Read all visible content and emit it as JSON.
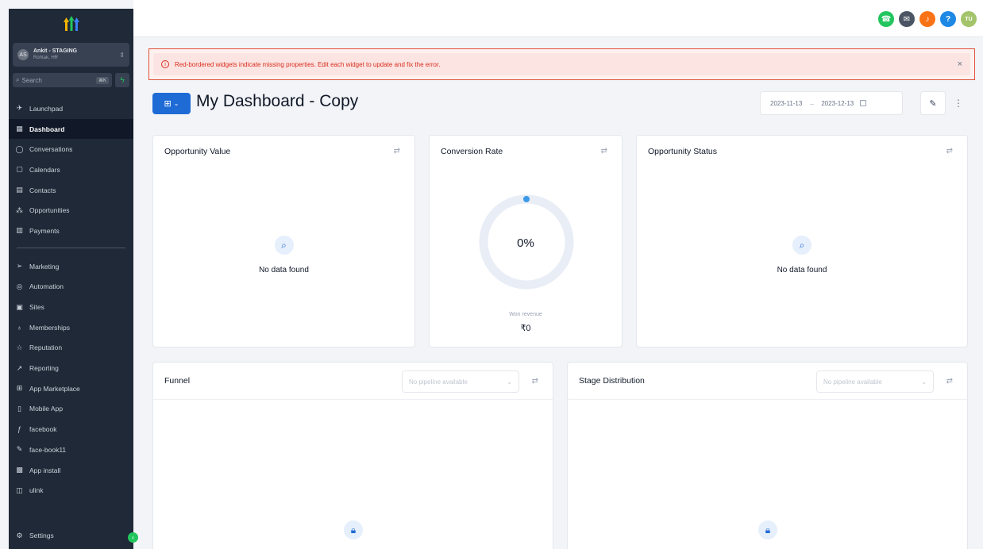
{
  "sidebar": {
    "account": {
      "avatar": "AS",
      "name": "Ankit - STAGING",
      "sub": "Rohtak, HR"
    },
    "search": {
      "placeholder": "Search",
      "shortcut": "⌘K"
    },
    "nav_top": [
      {
        "label": "Launchpad",
        "icon": "rocket-icon"
      },
      {
        "label": "Dashboard",
        "icon": "dashboard-grid-icon",
        "active": true
      },
      {
        "label": "Conversations",
        "icon": "chat-bubble-icon"
      },
      {
        "label": "Calendars",
        "icon": "calendar-icon"
      },
      {
        "label": "Contacts",
        "icon": "contacts-icon"
      },
      {
        "label": "Opportunities",
        "icon": "opportunities-icon"
      },
      {
        "label": "Payments",
        "icon": "payments-icon"
      }
    ],
    "nav_bottom": [
      {
        "label": "Marketing",
        "icon": "send-icon"
      },
      {
        "label": "Automation",
        "icon": "automation-icon"
      },
      {
        "label": "Sites",
        "icon": "sites-icon"
      },
      {
        "label": "Memberships",
        "icon": "membership-icon"
      },
      {
        "label": "Reputation",
        "icon": "star-icon"
      },
      {
        "label": "Reporting",
        "icon": "chart-line-icon"
      },
      {
        "label": "App Marketplace",
        "icon": "apps-grid-icon"
      },
      {
        "label": "Mobile App",
        "icon": "mobile-icon"
      },
      {
        "label": "facebook",
        "icon": "facebook-icon"
      },
      {
        "label": "face-book11",
        "icon": "brush-icon"
      },
      {
        "label": "App install",
        "icon": "app-install-icon"
      },
      {
        "label": "ulink",
        "icon": "link-box-icon"
      }
    ],
    "settings": {
      "label": "Settings",
      "icon": "gear-icon"
    }
  },
  "topbar": {
    "icons": [
      {
        "name": "phone-icon",
        "color": "#22c55e"
      },
      {
        "name": "megaphone-icon",
        "color": "#4b5563"
      },
      {
        "name": "bell-icon",
        "color": "#f97316"
      },
      {
        "name": "help-icon",
        "color": "#1e88e5",
        "glyph": "?"
      },
      {
        "name": "user-avatar",
        "color": "#a3c46a",
        "glyph": "TU"
      }
    ]
  },
  "alert": {
    "text": "Red-bordered widgets indicate missing properties. Edit each widget to update and fix the error.",
    "close": "×"
  },
  "header": {
    "title": "My Dashboard - Copy",
    "date_start": "2023-11-13",
    "date_arrow": "→",
    "date_end": "2023-12-13"
  },
  "widgets": {
    "opportunity_value": {
      "title": "Opportunity Value",
      "empty_text": "No data found"
    },
    "conversion_rate": {
      "title": "Conversion Rate",
      "percent_label": "0%",
      "percent": 0,
      "caption": "Won revenue",
      "amount": "₹0"
    },
    "opportunity_status": {
      "title": "Opportunity Status",
      "empty_text": "No data found"
    },
    "funnel": {
      "title": "Funnel",
      "select_placeholder": "No pipeline available"
    },
    "stage_distribution": {
      "title": "Stage Distribution",
      "select_placeholder": "No pipeline available"
    }
  },
  "colors": {
    "sidebar_bg": "#1f2937",
    "accent": "#1e6bd6",
    "alert_border": "#e0533d",
    "alert_text": "#d92d20"
  }
}
